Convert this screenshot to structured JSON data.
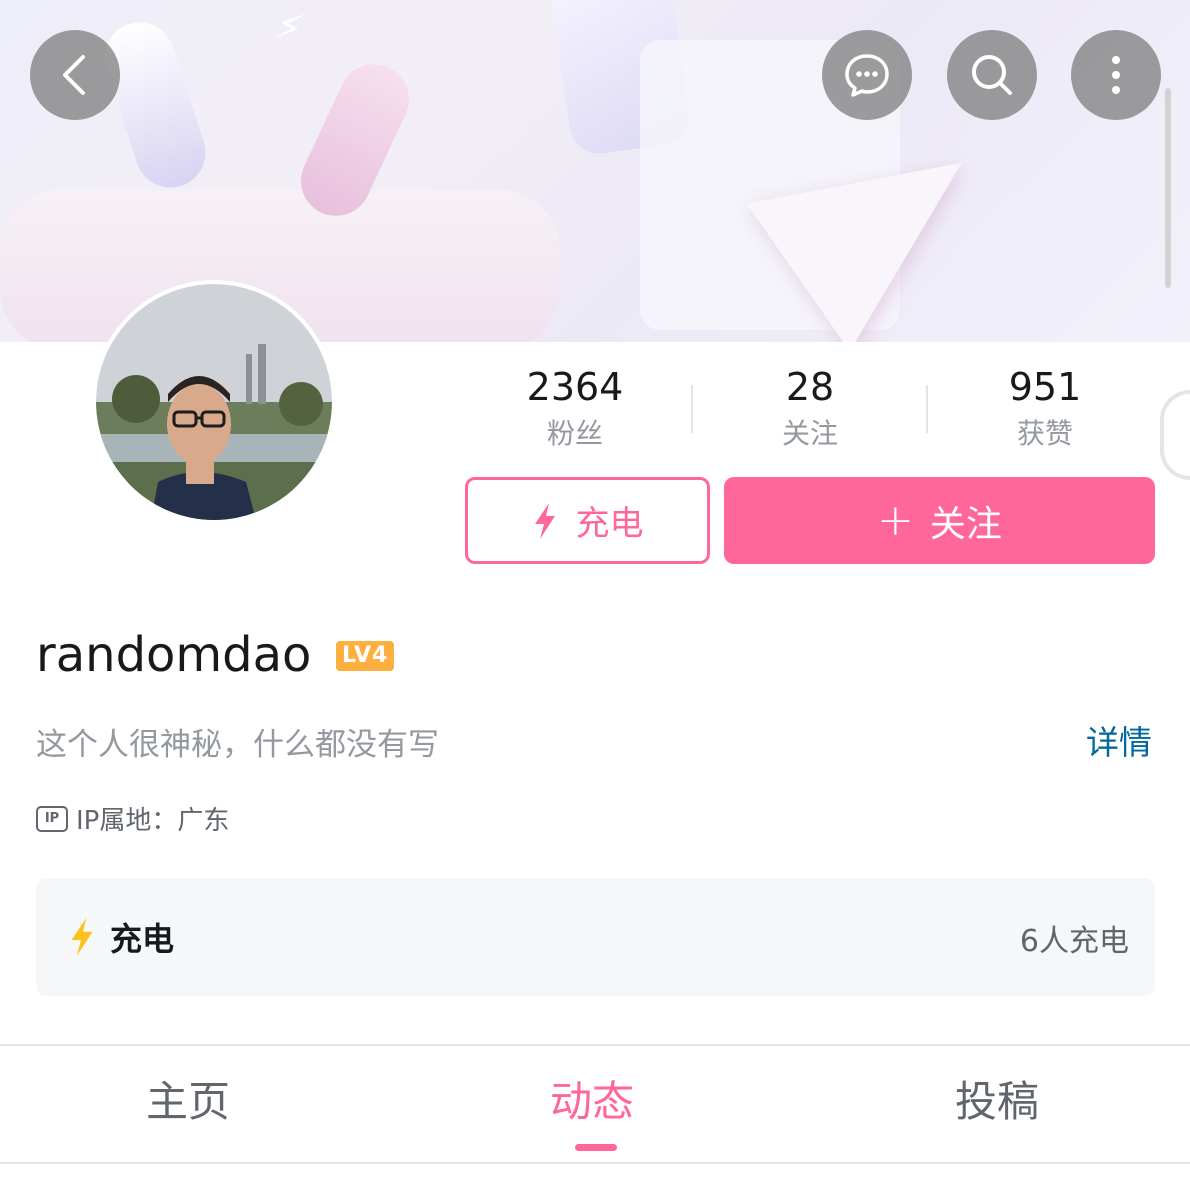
{
  "header": {
    "icons": [
      "back-icon",
      "chat-icon",
      "search-icon",
      "more-icon"
    ]
  },
  "profile": {
    "username": "randomdao",
    "level": "LV4",
    "bio": "这个人很神秘，什么都没有写",
    "detail_label": "详情",
    "ip_badge": "IP",
    "ip_location": "IP属地：广东"
  },
  "stats": [
    {
      "value": "2364",
      "label": "粉丝"
    },
    {
      "value": "28",
      "label": "关注"
    },
    {
      "value": "951",
      "label": "获赞"
    }
  ],
  "actions": {
    "charge_label": "充电",
    "follow_label": "关注",
    "follow_plus": "+"
  },
  "charge_card": {
    "title": "充电",
    "count": "6人充电"
  },
  "tabs": [
    {
      "label": "主页",
      "active": false
    },
    {
      "label": "动态",
      "active": true
    },
    {
      "label": "投稿",
      "active": false
    }
  ],
  "colors": {
    "accent_pink": "#ff6699",
    "link_blue": "#00699d",
    "level_badge": "#feb03f",
    "bolt_yellow": "#fcc21b"
  }
}
